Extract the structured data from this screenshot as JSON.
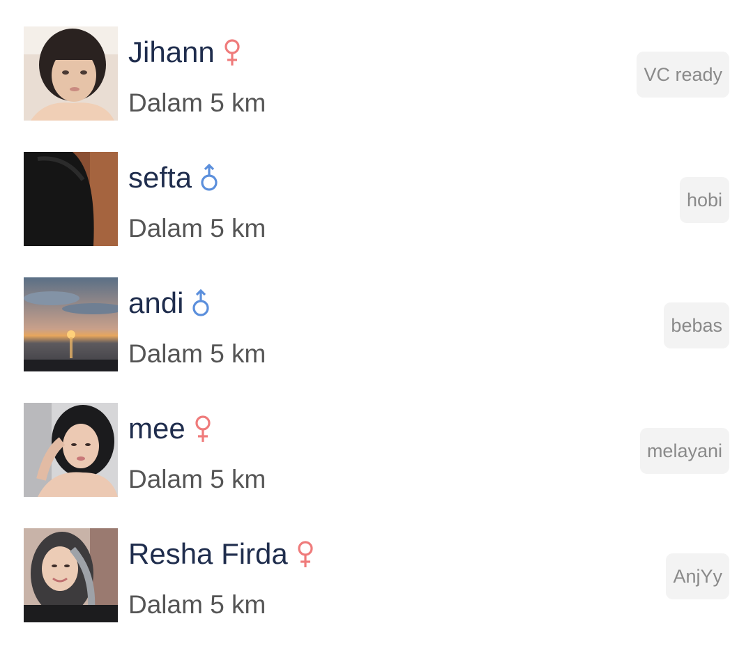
{
  "users": [
    {
      "name": "Jihann",
      "gender": "female",
      "gender_icon": "female-symbol-icon",
      "distance": "Dalam 5 km",
      "tag": "VC ready"
    },
    {
      "name": "sefta",
      "gender": "male",
      "gender_icon": "male-symbol-icon",
      "distance": "Dalam 5 km",
      "tag": "hobi"
    },
    {
      "name": "andi",
      "gender": "male",
      "gender_icon": "male-symbol-icon",
      "distance": "Dalam 5 km",
      "tag": "bebas"
    },
    {
      "name": "mee",
      "gender": "female",
      "gender_icon": "female-symbol-icon",
      "distance": "Dalam 5 km",
      "tag": "melayani"
    },
    {
      "name": "Resha Firda",
      "gender": "female",
      "gender_icon": "female-symbol-icon",
      "distance": "Dalam 5 km",
      "tag": "AnjYy"
    }
  ],
  "colors": {
    "name": "#1f2d4d",
    "distance": "#555555",
    "female": "#ef7b7b",
    "male": "#5b8fdc",
    "tag_bg": "#f3f3f3",
    "tag_text": "#8a8a8a"
  }
}
